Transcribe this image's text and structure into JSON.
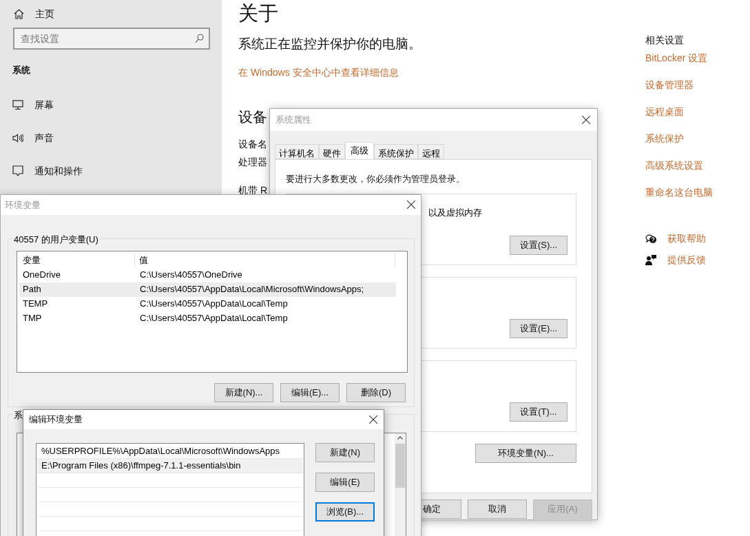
{
  "settings": {
    "home": {
      "label": "主页"
    },
    "search": {
      "placeholder": "查找设置"
    },
    "section": "系统",
    "items": [
      {
        "kind": "display",
        "label": "屏幕"
      },
      {
        "kind": "sound",
        "label": "声音"
      },
      {
        "kind": "notify",
        "label": "通知和操作"
      }
    ],
    "title": "关于",
    "status": "系统正在监控并保护你的电脑。",
    "security_link": "在 Windows 安全中心中查看详细信息",
    "spec_heading": "设备",
    "spec_labels": [
      "设备名",
      "处理器",
      "机带 R"
    ],
    "related": {
      "title": "相关设置",
      "links": [
        "BitLocker 设置",
        "设备管理器",
        "远程桌面",
        "系统保护",
        "高级系统设置",
        "重命名这台电脑"
      ]
    },
    "help": [
      {
        "kind": "help",
        "label": "获取帮助"
      },
      {
        "kind": "feedback",
        "label": "提供反馈"
      }
    ]
  },
  "system_properties": {
    "title": "系统属性",
    "tabs": [
      {
        "label": "计算机名",
        "selected": false
      },
      {
        "label": "硬件",
        "selected": false
      },
      {
        "label": "高级",
        "selected": true
      },
      {
        "label": "系统保护",
        "selected": false
      },
      {
        "label": "远程",
        "selected": false
      }
    ],
    "note": "要进行大多数更改，你必须作为管理员登录。",
    "groups": [
      {
        "description": "以及虚拟内存",
        "button": "设置(S)..."
      },
      {
        "button": "设置(E)..."
      },
      {
        "button": "设置(T)..."
      }
    ],
    "env_button": "环境变量(N)...",
    "buttons": [
      {
        "label": "确定",
        "disabled": false
      },
      {
        "label": "取消",
        "disabled": false
      },
      {
        "label": "应用(A)",
        "disabled": true
      }
    ]
  },
  "env_vars": {
    "title": "环境变量",
    "user_group": "40557 的用户变量(U)",
    "columns": [
      "变量",
      "值"
    ],
    "rows": [
      {
        "name": "OneDrive",
        "value": "C:\\Users\\40557\\OneDrive",
        "selected": false
      },
      {
        "name": "Path",
        "value": "C:\\Users\\40557\\AppData\\Local\\Microsoft\\WindowsApps;",
        "selected": true
      },
      {
        "name": "TEMP",
        "value": "C:\\Users\\40557\\AppData\\Local\\Temp",
        "selected": false
      },
      {
        "name": "TMP",
        "value": "C:\\Users\\40557\\AppData\\Local\\Temp",
        "selected": false
      }
    ],
    "buttons": [
      "新建(N)...",
      "编辑(E)...",
      "删除(D)"
    ],
    "system_group": "系"
  },
  "edit_env": {
    "title": "编辑环境变量",
    "entries": [
      {
        "value": "%USERPROFILE%\\AppData\\Local\\Microsoft\\WindowsApps",
        "selected": false
      },
      {
        "value": "E:\\Program Files (x86)\\ffmpeg-7.1.1-essentials\\bin",
        "selected": true
      }
    ],
    "buttons": [
      {
        "label": "新建(N)",
        "focused": false
      },
      {
        "label": "编辑(E)",
        "focused": false
      },
      {
        "label": "浏览(B)...",
        "focused": true
      }
    ]
  }
}
